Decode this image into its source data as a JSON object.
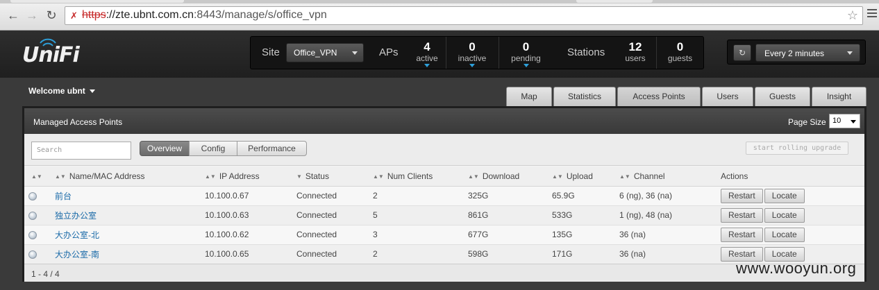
{
  "browser": {
    "url_scheme": "https",
    "url_rest": "://zte.ubnt.com.cn",
    "url_port_path": ":8443/manage/s/office_vpn"
  },
  "header": {
    "logo": "UniFi",
    "site_label": "Site",
    "site_value": "Office_VPN",
    "aps_label": "APs",
    "ap_stats": [
      {
        "num": "4",
        "label": "active"
      },
      {
        "num": "0",
        "label": "inactive"
      },
      {
        "num": "0",
        "label": "pending"
      }
    ],
    "stations_label": "Stations",
    "station_stats": [
      {
        "num": "12",
        "label": "users"
      },
      {
        "num": "0",
        "label": "guests"
      }
    ],
    "refresh_interval": "Every 2 minutes"
  },
  "subbar": {
    "welcome": "Welcome ubnt",
    "tabs": [
      "Map",
      "Statistics",
      "Access Points",
      "Users",
      "Guests",
      "Insight"
    ],
    "active_tab": "Access Points"
  },
  "panel": {
    "title": "Managed Access Points",
    "page_size_label": "Page Size",
    "page_size": "10",
    "search_placeholder": "Search",
    "view_tabs": [
      "Overview",
      "Config",
      "Performance"
    ],
    "active_view": "Overview",
    "rolling_upgrade": "start rolling upgrade",
    "columns": [
      "Name/MAC Address",
      "IP Address",
      "Status",
      "Num Clients",
      "Download",
      "Upload",
      "Channel",
      "Actions"
    ],
    "rows": [
      {
        "name": "前台",
        "ip": "10.100.0.67",
        "status": "Connected",
        "clients": "2",
        "download": "325G",
        "upload": "65.9G",
        "channel": "6 (ng), 36 (na)"
      },
      {
        "name": "独立办公室",
        "ip": "10.100.0.63",
        "status": "Connected",
        "clients": "5",
        "download": "861G",
        "upload": "533G",
        "channel": "1 (ng), 48 (na)"
      },
      {
        "name": "大办公室-北",
        "ip": "10.100.0.62",
        "status": "Connected",
        "clients": "3",
        "download": "677G",
        "upload": "135G",
        "channel": "36 (na)"
      },
      {
        "name": "大办公室-南",
        "ip": "10.100.0.65",
        "status": "Connected",
        "clients": "2",
        "download": "598G",
        "upload": "171G",
        "channel": "36 (na)"
      }
    ],
    "restart_label": "Restart",
    "locate_label": "Locate",
    "pager": "1 - 4 / 4"
  },
  "watermark": "www.wooyun.org",
  "colors": {
    "accent": "#2d9fd9",
    "connected": "#2f8f2f",
    "link": "#1a6aa8"
  }
}
